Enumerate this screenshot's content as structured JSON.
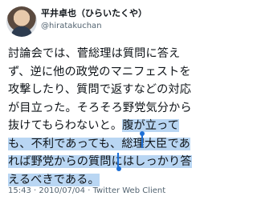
{
  "user": {
    "display_name": "平井卓也（ひらいたくや）",
    "handle": "@hiratakuchan"
  },
  "tweet": {
    "lines": [
      "討論会では、菅総理は質問に答え",
      "ず、逆に他の政党のマニフェストを",
      "攻撃したり、質問で返すなどの対応",
      "が目立った。そろそろ野党気分から",
      "抜けてもらわないと。",
      "腹が立って",
      "も、不利であっても、総理大臣であ",
      "れば野党からの質問にはしっかり答",
      "えるべきである。"
    ]
  },
  "meta": {
    "time": "15:43",
    "date": "2010/07/04",
    "client": "Twitter Web Client"
  },
  "colors": {
    "selection": "#b9d6f3",
    "caret": "#1d6fd6"
  }
}
